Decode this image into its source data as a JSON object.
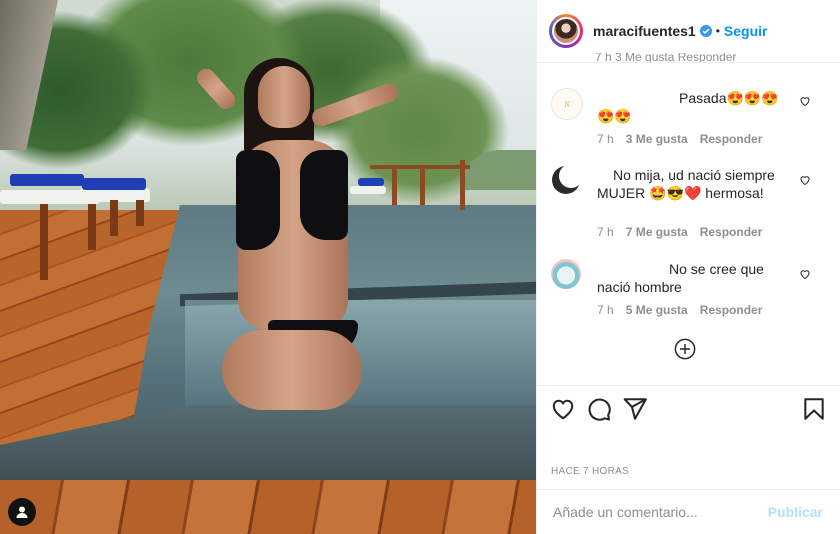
{
  "post": {
    "username": "maracifuentes1",
    "follow_label": "Seguir",
    "separator": "•",
    "clipped_line": "7 h   3 Me gusta   Responder"
  },
  "comments": [
    {
      "text": "Pasada😍😍😍😍😍",
      "time": "7 h",
      "likes": "3 Me gusta",
      "reply": "Responder"
    },
    {
      "text": "No mija, ud nació siempre MUJER 🤩😎❤️ hermosa!",
      "time": "7 h",
      "likes": "7 Me gusta",
      "reply": "Responder"
    },
    {
      "text": "No se cree que nació hombre",
      "time": "7 h",
      "likes": "5 Me gusta",
      "reply": "Responder"
    }
  ],
  "actions": {
    "timestamp": "HACE 7 HORAS"
  },
  "composer": {
    "placeholder": "Añade un comentario...",
    "publish_label": "Publicar"
  },
  "icons": {
    "like": "heart-icon",
    "comment": "comment-icon",
    "share": "share-icon",
    "save": "bookmark-icon",
    "more": "plus-circle-icon",
    "tag": "user-tag-icon"
  },
  "colors": {
    "accent": "#0095f6",
    "publish_disabled": "#b2dffc",
    "muted": "#8e8e8e",
    "text": "#262626"
  }
}
